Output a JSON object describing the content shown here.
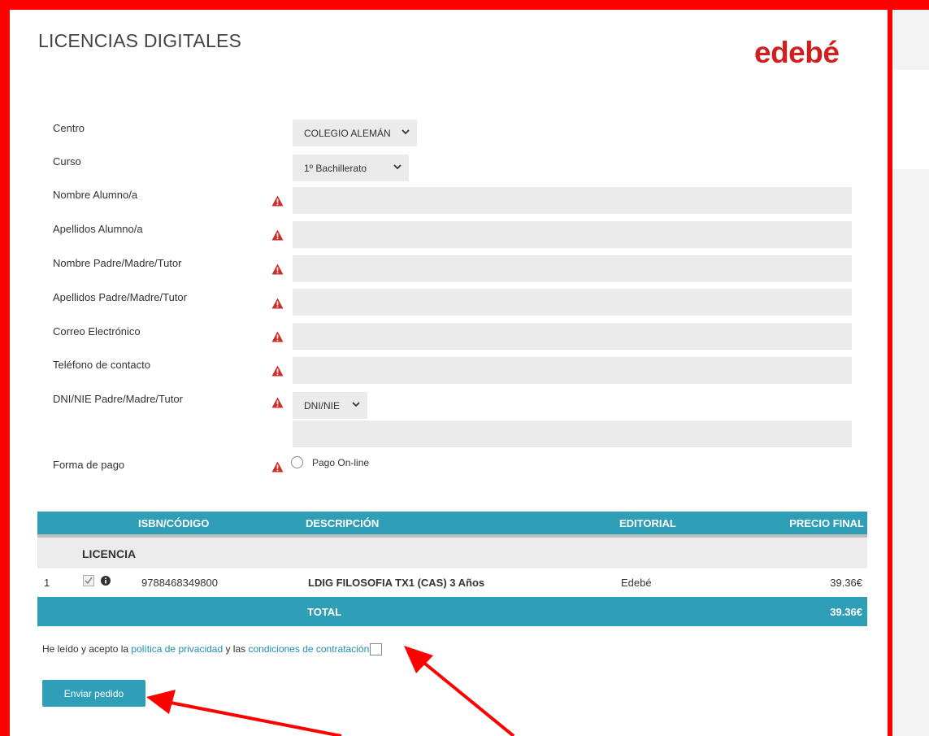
{
  "header": {
    "title": "LICENCIAS DIGITALES",
    "logo_text": "edebé"
  },
  "form": {
    "centro": {
      "label": "Centro",
      "value": "COLEGIO ALEMÁN"
    },
    "curso": {
      "label": "Curso",
      "value": "1º Bachillerato"
    },
    "nombre_alumno": {
      "label": "Nombre Alumno/a",
      "value": ""
    },
    "apellidos_alumno": {
      "label": "Apellidos Alumno/a",
      "value": ""
    },
    "nombre_tutor": {
      "label": "Nombre Padre/Madre/Tutor",
      "value": ""
    },
    "apellidos_tutor": {
      "label": "Apellidos Padre/Madre/Tutor",
      "value": ""
    },
    "correo": {
      "label": "Correo Electrónico",
      "value": ""
    },
    "telefono": {
      "label": "Teléfono de contacto",
      "value": ""
    },
    "dni": {
      "label": "DNI/NIE Padre/Madre/Tutor",
      "type_value": "DNI/NIE",
      "value": ""
    },
    "pago": {
      "label": "Forma de pago",
      "option": "Pago On-line",
      "selected": false
    }
  },
  "table": {
    "headers": {
      "isbn": "ISBN/CÓDIGO",
      "descripcion": "DESCRIPCIÓN",
      "editorial": "EDITORIAL",
      "precio": "PRECIO FINAL"
    },
    "group_label": "LICENCIA",
    "rows": [
      {
        "index": "1",
        "checked": true,
        "isbn": "9788468349800",
        "descripcion": "LDIG FILOSOFIA TX1 (CAS) 3 Años",
        "editorial": "Edebé",
        "precio": "39.36€"
      }
    ],
    "total_label": "TOTAL",
    "total_value": "39.36€"
  },
  "terms": {
    "prefix": "He leído y acepto la ",
    "privacy_link": "política de privacidad",
    "middle": " y las ",
    "conditions_link": "condiciones de contratación",
    "checked": false
  },
  "submit_label": "Enviar pedido",
  "colors": {
    "accent": "#2e9fb6",
    "logo": "#d11e1e",
    "frame": "#ff0000",
    "warning": "#c9302c"
  }
}
